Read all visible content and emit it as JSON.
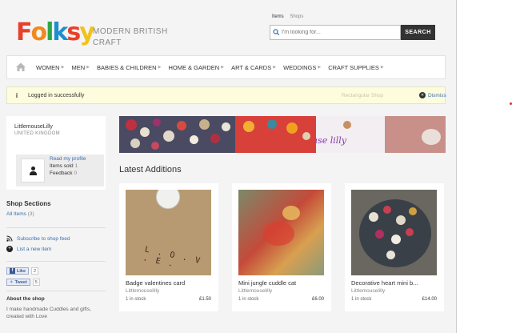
{
  "header": {
    "logo_letters": [
      "F",
      "o",
      "l",
      "k",
      "s",
      "y"
    ],
    "logo_colors": [
      "#e8402a",
      "#f08a1c",
      "#2aa84a",
      "#1c8fd0",
      "#e8402a",
      "#f2c21a"
    ],
    "tagline": "MODERN BRITISH CRAFT",
    "search_tabs": [
      "Items",
      "Shops"
    ],
    "search_placeholder": "I'm looking for...",
    "search_button": "SEARCH"
  },
  "nav": {
    "items": [
      "WOMEN",
      "MEN",
      "BABIES & CHILDREN",
      "HOME & GARDEN",
      "ART & CARDS",
      "WEDDINGS",
      "CRAFT SUPPLIES"
    ]
  },
  "notice": {
    "message": "Logged in successfully",
    "faded_text": "Rectangular Shop",
    "dismiss": "Dismiss"
  },
  "profile": {
    "username": "LittlemouseLilly",
    "country": "UNITED KINGDOM",
    "read_profile": "Read my profile",
    "items_sold_label": "Items sold",
    "items_sold": "1",
    "feedback_label": "Feedback",
    "feedback": "0"
  },
  "sidebar": {
    "shop_sections_title": "Shop Sections",
    "all_items": "All Items",
    "all_items_count": "(3)",
    "subscribe": "Subscribe to shop feed",
    "list_new": "List a new item",
    "like_label": "Like",
    "like_count": "2",
    "tweet_label": "Tweet",
    "tweet_count": "5",
    "about_title": "About the shop",
    "about_text": "I make handmade Cuddles and gifts, created with Love"
  },
  "banner": {
    "script_text": "littlemouse lilly"
  },
  "main": {
    "latest_title": "Latest Additions",
    "products": [
      {
        "name": "Badge valentines card",
        "shop": "Littlemouselilly",
        "stock": "1 in stock",
        "price": "£1.50",
        "image_text": "L . O . V . E ."
      },
      {
        "name": "Mini jungle cuddle cat",
        "shop": "Littlemouselilly",
        "stock": "1 in stock",
        "price": "£6.00"
      },
      {
        "name": "Decorative heart mini b...",
        "shop": "Littlemouselilly",
        "stock": "1 in stock",
        "price": "£14.00"
      }
    ]
  }
}
